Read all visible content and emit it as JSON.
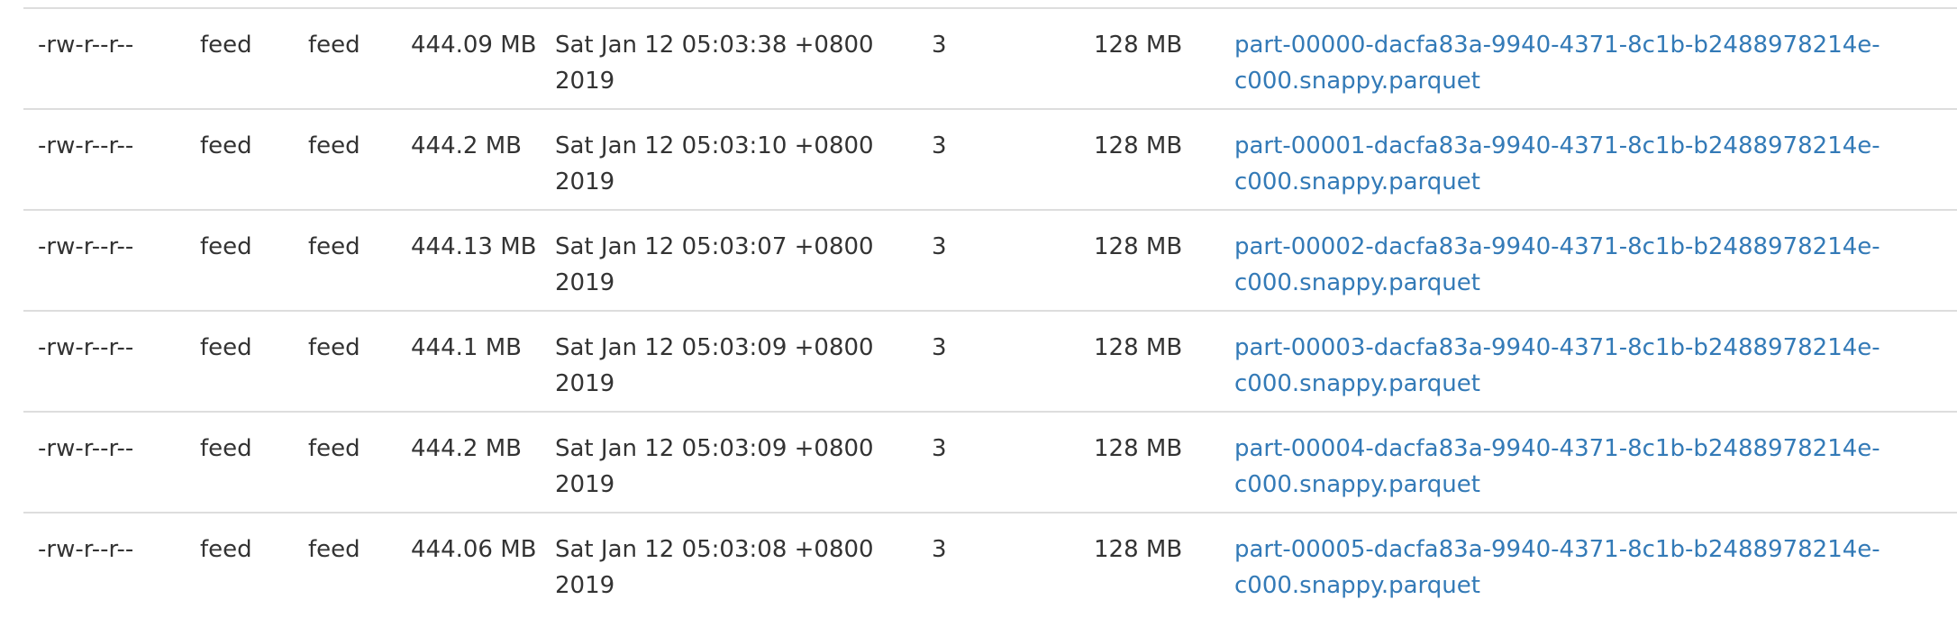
{
  "rows": [
    {
      "permission": "-rw-r--r--",
      "owner": "feed",
      "group": "feed",
      "size": "444.09 MB",
      "last_modified": "Sat Jan 12 05:03:38 +0800 2019",
      "replication": "3",
      "block_size": "128 MB",
      "name": "part-00000-dacfa83a-9940-4371-8c1b-b2488978214e-c000.snappy.parquet"
    },
    {
      "permission": "-rw-r--r--",
      "owner": "feed",
      "group": "feed",
      "size": "444.2 MB",
      "last_modified": "Sat Jan 12 05:03:10 +0800 2019",
      "replication": "3",
      "block_size": "128 MB",
      "name": "part-00001-dacfa83a-9940-4371-8c1b-b2488978214e-c000.snappy.parquet"
    },
    {
      "permission": "-rw-r--r--",
      "owner": "feed",
      "group": "feed",
      "size": "444.13 MB",
      "last_modified": "Sat Jan 12 05:03:07 +0800 2019",
      "replication": "3",
      "block_size": "128 MB",
      "name": "part-00002-dacfa83a-9940-4371-8c1b-b2488978214e-c000.snappy.parquet"
    },
    {
      "permission": "-rw-r--r--",
      "owner": "feed",
      "group": "feed",
      "size": "444.1 MB",
      "last_modified": "Sat Jan 12 05:03:09 +0800 2019",
      "replication": "3",
      "block_size": "128 MB",
      "name": "part-00003-dacfa83a-9940-4371-8c1b-b2488978214e-c000.snappy.parquet"
    },
    {
      "permission": "-rw-r--r--",
      "owner": "feed",
      "group": "feed",
      "size": "444.2 MB",
      "last_modified": "Sat Jan 12 05:03:09 +0800 2019",
      "replication": "3",
      "block_size": "128 MB",
      "name": "part-00004-dacfa83a-9940-4371-8c1b-b2488978214e-c000.snappy.parquet"
    },
    {
      "permission": "-rw-r--r--",
      "owner": "feed",
      "group": "feed",
      "size": "444.06 MB",
      "last_modified": "Sat Jan 12 05:03:08 +0800 2019",
      "replication": "3",
      "block_size": "128 MB",
      "name": "part-00005-dacfa83a-9940-4371-8c1b-b2488978214e-c000.snappy.parquet"
    }
  ],
  "colors": {
    "link": "#337ab7",
    "text": "#333333",
    "row_border": "#dddddd"
  }
}
